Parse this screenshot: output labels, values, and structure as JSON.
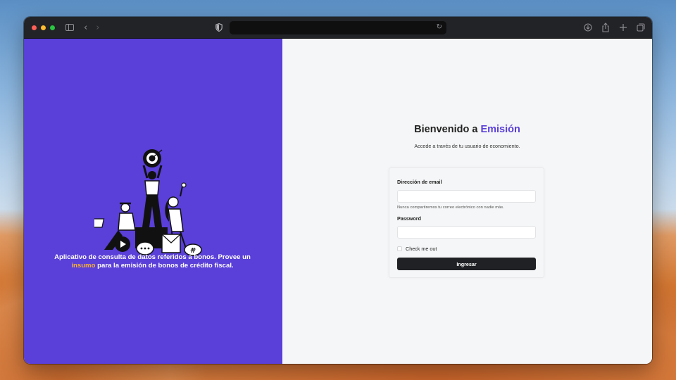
{
  "browser": {
    "url": "",
    "icons": {
      "sidebar": "sidebar-toggle-icon",
      "back": "chevron-left-icon",
      "forward": "chevron-right-icon",
      "privacy": "shield-icon",
      "reload": "reload-icon",
      "downloads": "download-icon",
      "share": "share-icon",
      "new_tab": "plus-icon",
      "tabs": "tab-overview-icon"
    }
  },
  "left_panel": {
    "background_color": "#5a3fd8",
    "tagline_before": "Aplicativo de consulta de datos referidos a bonos. Provee un",
    "tagline_highlight": "insumo",
    "tagline_after": "para la emisión de bonos de crédito fiscal.",
    "highlight_color": "#f9b233"
  },
  "login": {
    "title_prefix": "Bienvenido a",
    "title_brand": "Emisión",
    "subtitle": "Accede a través de tu usuario de economiento.",
    "email_label": "Dirección de email",
    "email_value": "",
    "email_help": "Nunca compartiremos tu correo electrónico con nadie más.",
    "password_label": "Password",
    "password_value": "",
    "remember_label": "Check me out",
    "remember_checked": false,
    "submit_label": "Ingresar"
  }
}
